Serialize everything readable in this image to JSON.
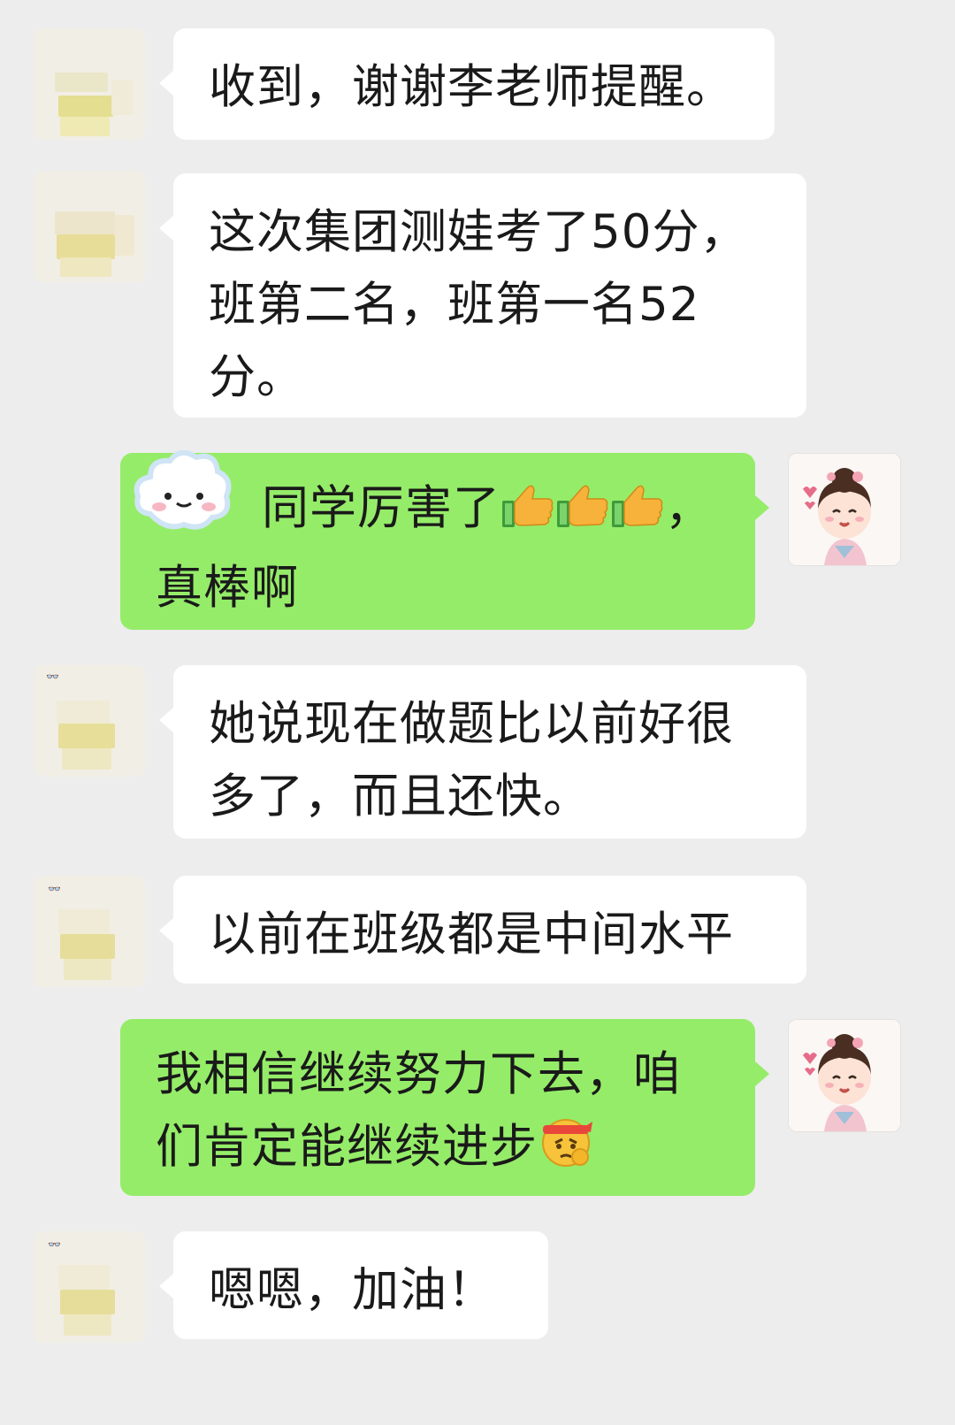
{
  "messages": [
    {
      "side": "in",
      "text": "收到，谢谢李老师提醒。"
    },
    {
      "side": "in",
      "text": "这次集团测娃考了50分，\n班第二名，班第一名52\n分。"
    },
    {
      "side": "out",
      "text_a": "同学厉害了",
      "emoji": [
        "thumbs-up",
        "thumbs-up",
        "thumbs-up"
      ],
      "text_b": "，\n真棒啊"
    },
    {
      "side": "in",
      "text": "她说现在做题比以前好很\n多了，而且还快。"
    },
    {
      "side": "in",
      "text": "以前在班级都是中间水平"
    },
    {
      "side": "out",
      "text_a": "我相信继续努力下去，咱\n们肯定能继续进步",
      "emoji": [
        "fighting-face"
      ]
    },
    {
      "side": "in",
      "text": "嗯嗯，加油！"
    }
  ],
  "avatars": {
    "parent": "blurred-avatar",
    "teacher": "cartoon-girl-avatar"
  },
  "sticker": "cloud-face-sticker",
  "colors": {
    "background": "#ededed",
    "incoming_bubble": "#ffffff",
    "outgoing_bubble": "#95ec69",
    "text": "#1a1a1a"
  }
}
